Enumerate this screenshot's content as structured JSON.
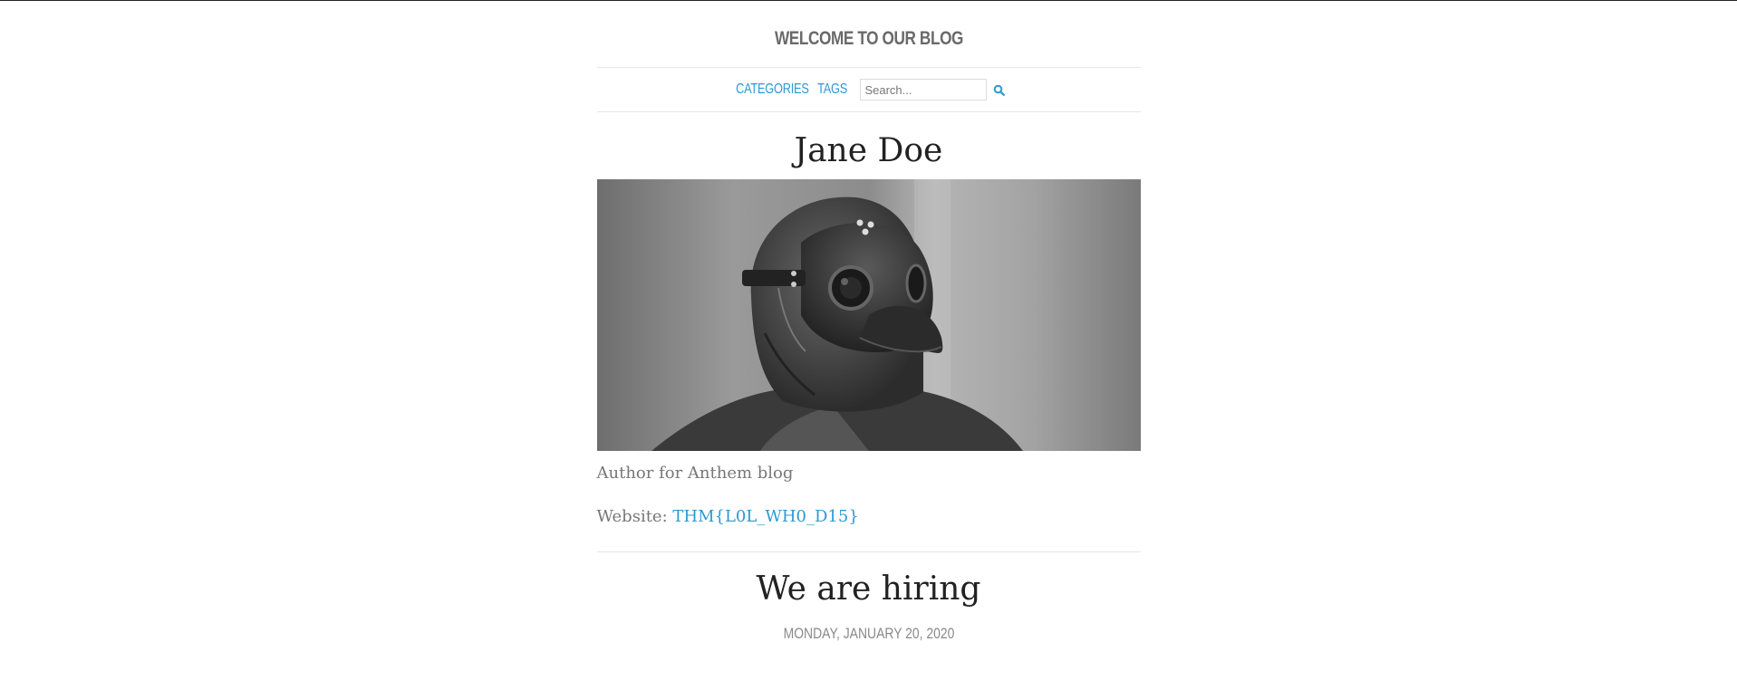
{
  "header": {
    "site_title": "WELCOME TO OUR BLOG"
  },
  "nav": {
    "categories": "CATEGORIES",
    "tags": "TAGS",
    "search_placeholder": "Search...",
    "search_icon": "search-icon"
  },
  "author": {
    "name": "Jane Doe",
    "photo_alt": "plague-doctor-mask-photo",
    "bio": "Author for Anthem blog",
    "website_label": "Website:",
    "website_link": "THM{L0L_WH0_D15}"
  },
  "post": {
    "title": "We are hiring",
    "date": "MONDAY, JANUARY 20, 2020"
  },
  "colors": {
    "link": "#2b9ad1",
    "muted": "#777777",
    "title": "#222222"
  }
}
